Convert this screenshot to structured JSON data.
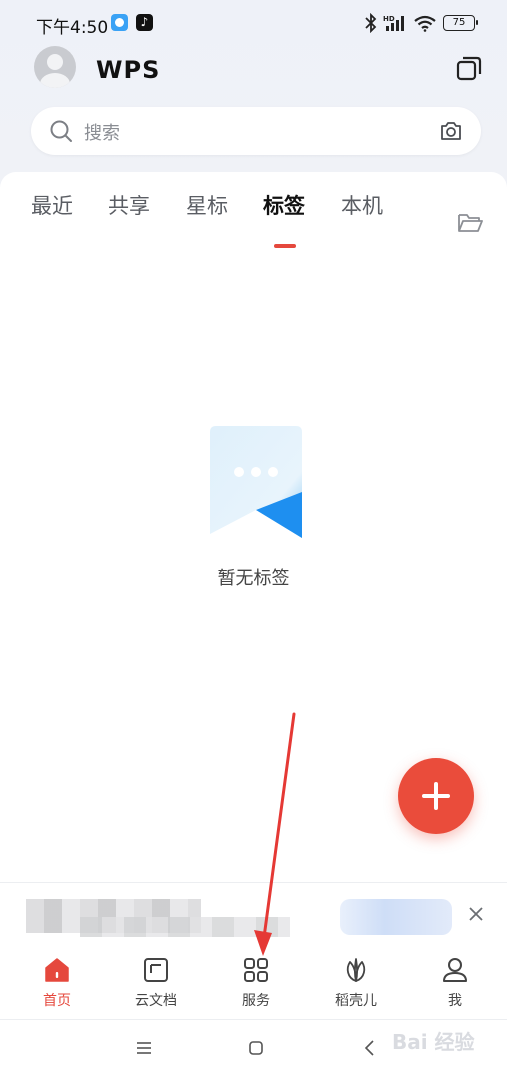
{
  "status_bar": {
    "time": "下午4:50",
    "battery": "75"
  },
  "header": {
    "logo": "WPS"
  },
  "search": {
    "placeholder": "搜索"
  },
  "tabs": [
    {
      "label": "最近",
      "active": false
    },
    {
      "label": "共享",
      "active": false
    },
    {
      "label": "星标",
      "active": false
    },
    {
      "label": "标签",
      "active": true
    },
    {
      "label": "本机",
      "active": false
    }
  ],
  "empty_state": {
    "message": "暂无标签"
  },
  "bottom_nav": [
    {
      "label": "首页",
      "icon": "home-icon",
      "active": true
    },
    {
      "label": "云文档",
      "icon": "cloud-doc-icon",
      "active": false
    },
    {
      "label": "服务",
      "icon": "grid-icon",
      "active": false
    },
    {
      "label": "稻壳儿",
      "icon": "leaf-icon",
      "active": false
    },
    {
      "label": "我",
      "icon": "user-icon",
      "active": false
    }
  ],
  "watermark": "Bai 经验",
  "colors": {
    "accent": "#e5483d",
    "fab": "#ea4c3b",
    "annotation_arrow": "#e53935"
  }
}
